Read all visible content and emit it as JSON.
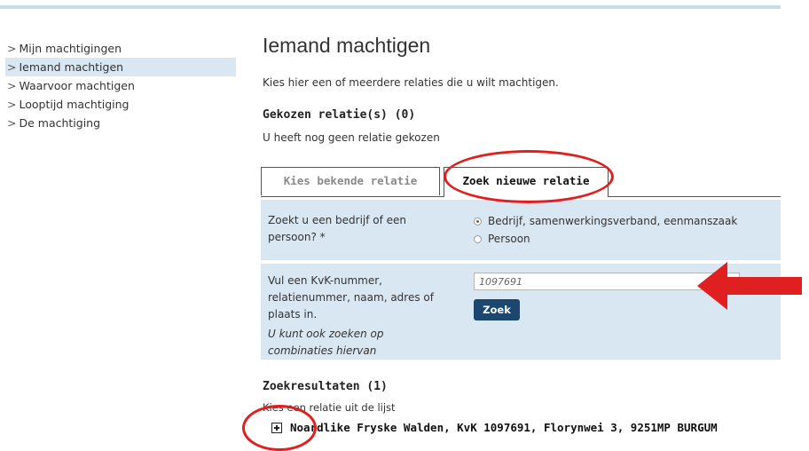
{
  "sidebar": {
    "items": [
      {
        "label": "Mijn machtigingen",
        "active": false
      },
      {
        "label": "Iemand machtigen",
        "active": true
      },
      {
        "label": "Waarvoor machtigen",
        "active": false
      },
      {
        "label": "Looptijd machtiging",
        "active": false
      },
      {
        "label": "De machtiging",
        "active": false
      }
    ]
  },
  "main": {
    "title": "Iemand machtigen",
    "intro": "Kies hier een of meerdere relaties die u wilt machtigen.",
    "chosen_heading": "Gekozen relatie(s) (0)",
    "chosen_note": "U heeft nog geen relatie gekozen",
    "tabs": [
      {
        "label": "Kies bekende relatie",
        "active": false
      },
      {
        "label": "Zoek nieuwe relatie",
        "active": true
      }
    ],
    "form": {
      "question_label": "Zoekt u een bedrijf of een persoon? *",
      "options": [
        {
          "label": "Bedrijf, samenwerkingsverband, eenmanszaak",
          "checked": true
        },
        {
          "label": "Persoon",
          "checked": false
        }
      ],
      "search_label": "Vul een KvK-nummer, relatienummer, naam, adres of plaats in.",
      "search_hint": "U kunt ook zoeken op combinaties hiervan",
      "search_value": "1097691",
      "search_button": "Zoek"
    },
    "results": {
      "heading": "Zoekresultaten (1)",
      "note": "Kies een relatie uit de lijst",
      "items": [
        {
          "label": "Noardlike Fryske Walden, KvK 1097691, Florynwei 3, 9251MP BURGUM"
        }
      ]
    }
  },
  "annotations": {
    "color": "#e02020"
  }
}
